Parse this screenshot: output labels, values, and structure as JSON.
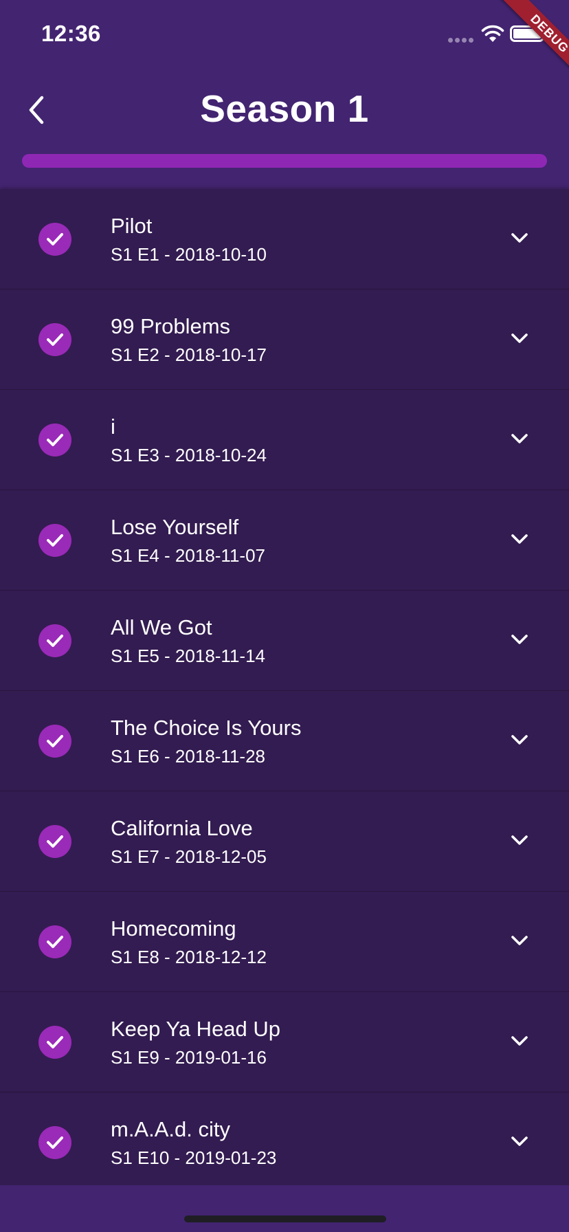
{
  "status_bar": {
    "time": "12:36"
  },
  "debug_banner": {
    "label": "DEBUG"
  },
  "header": {
    "title": "Season 1",
    "back_icon": "chevron-left-icon",
    "progress_fraction": 1.0
  },
  "colors": {
    "background": "#432471",
    "list_background": "#331c51",
    "accent": "#9a2ab8",
    "progress": "#8f27b5",
    "debug_ribbon": "#a02030"
  },
  "episodes": [
    {
      "title": "Pilot",
      "meta": "S1 E1 - 2018-10-10",
      "watched": true
    },
    {
      "title": "99 Problems",
      "meta": "S1 E2 - 2018-10-17",
      "watched": true
    },
    {
      "title": "i",
      "meta": "S1 E3 - 2018-10-24",
      "watched": true
    },
    {
      "title": "Lose Yourself",
      "meta": "S1 E4 - 2018-11-07",
      "watched": true
    },
    {
      "title": "All We Got",
      "meta": "S1 E5 - 2018-11-14",
      "watched": true
    },
    {
      "title": "The Choice Is Yours",
      "meta": "S1 E6 - 2018-11-28",
      "watched": true
    },
    {
      "title": "California Love",
      "meta": "S1 E7 - 2018-12-05",
      "watched": true
    },
    {
      "title": "Homecoming",
      "meta": "S1 E8 - 2018-12-12",
      "watched": true
    },
    {
      "title": "Keep Ya Head Up",
      "meta": "S1 E9 - 2019-01-16",
      "watched": true
    },
    {
      "title": "m.A.A.d. city",
      "meta": "S1 E10 - 2019-01-23",
      "watched": true
    }
  ]
}
